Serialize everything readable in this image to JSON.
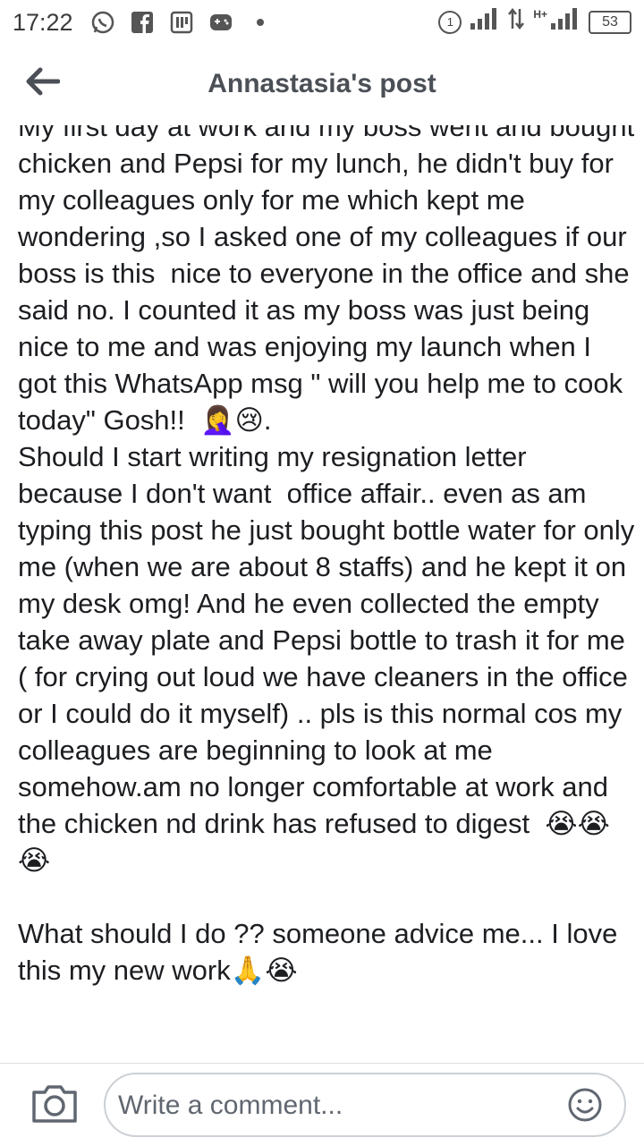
{
  "status_bar": {
    "time": "17:22",
    "battery": "53",
    "sim_label": "1",
    "network_label": "H+",
    "icons": [
      "whatsapp-icon",
      "facebook-icon",
      "pdf-icon",
      "gamepad-icon",
      "dot-icon",
      "sim-icon",
      "signal-icon",
      "data-icon",
      "signal-icon",
      "battery-icon"
    ]
  },
  "header": {
    "title": "Annastasia's post",
    "back_icon": "back-arrow-icon"
  },
  "post": {
    "text_before_emoji1": "My first day at work and my boss went and bought chicken and Pepsi for my lunch, he didn't buy for my colleagues only for me which kept me wondering ,so I asked one of my colleagues if our boss is this  nice to everyone in the office and she said no. I counted it as my boss was just being nice to me and was enjoying my launch when I got this WhatsApp msg \" will you help me to cook today\" Gosh!!  ",
    "emoji1": "🤦‍♀️😢",
    "text_after_emoji1": ".\nShould I start writing my resignation letter because I don't want  office affair.. even as am typing this post he just bought bottle water for only me (when we are about 8 staffs) and he kept it on my desk omg! And he even collected the empty take away plate and Pepsi bottle to trash it for me ( for crying out loud we have cleaners in the office or I could do it myself) .. pls is this normal cos my colleagues are beginning to look at me somehow.am no longer comfortable at work and the chicken nd drink has refused to digest  ",
    "emoji2": "😭😭😭",
    "text_after_emoji2": "\n\nWhat should I do ?? someone advice me... I love this my new work",
    "emoji3": "🙏😭"
  },
  "comment_bar": {
    "placeholder": "Write a comment...",
    "camera_icon": "camera-icon",
    "emoji_icon": "smiley-icon"
  }
}
